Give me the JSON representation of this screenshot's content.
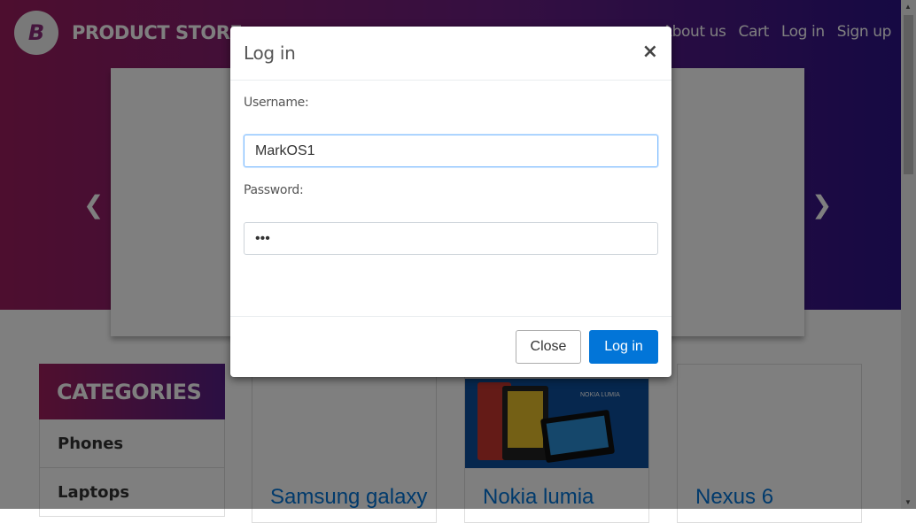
{
  "header": {
    "brand": "PRODUCT STORE",
    "logo_letter": "B",
    "nav": [
      "About us",
      "Cart",
      "Log in",
      "Sign up"
    ]
  },
  "sidebar": {
    "title": "CATEGORIES",
    "items": [
      "Phones",
      "Laptops"
    ]
  },
  "products": [
    "Samsung galaxy",
    "Nokia lumia",
    "Nexus 6"
  ],
  "product_image_text": "NOKIA LUMIA",
  "modal": {
    "title": "Log in",
    "close_symbol": "×",
    "username_label": "Username:",
    "username_value": "MarkOS1",
    "password_label": "Password:",
    "password_value": "•••",
    "close_button": "Close",
    "login_button": "Log in"
  },
  "colors": {
    "primary": "#0275d8",
    "hero_start": "#9b1d5e",
    "hero_end": "#2c1387"
  }
}
